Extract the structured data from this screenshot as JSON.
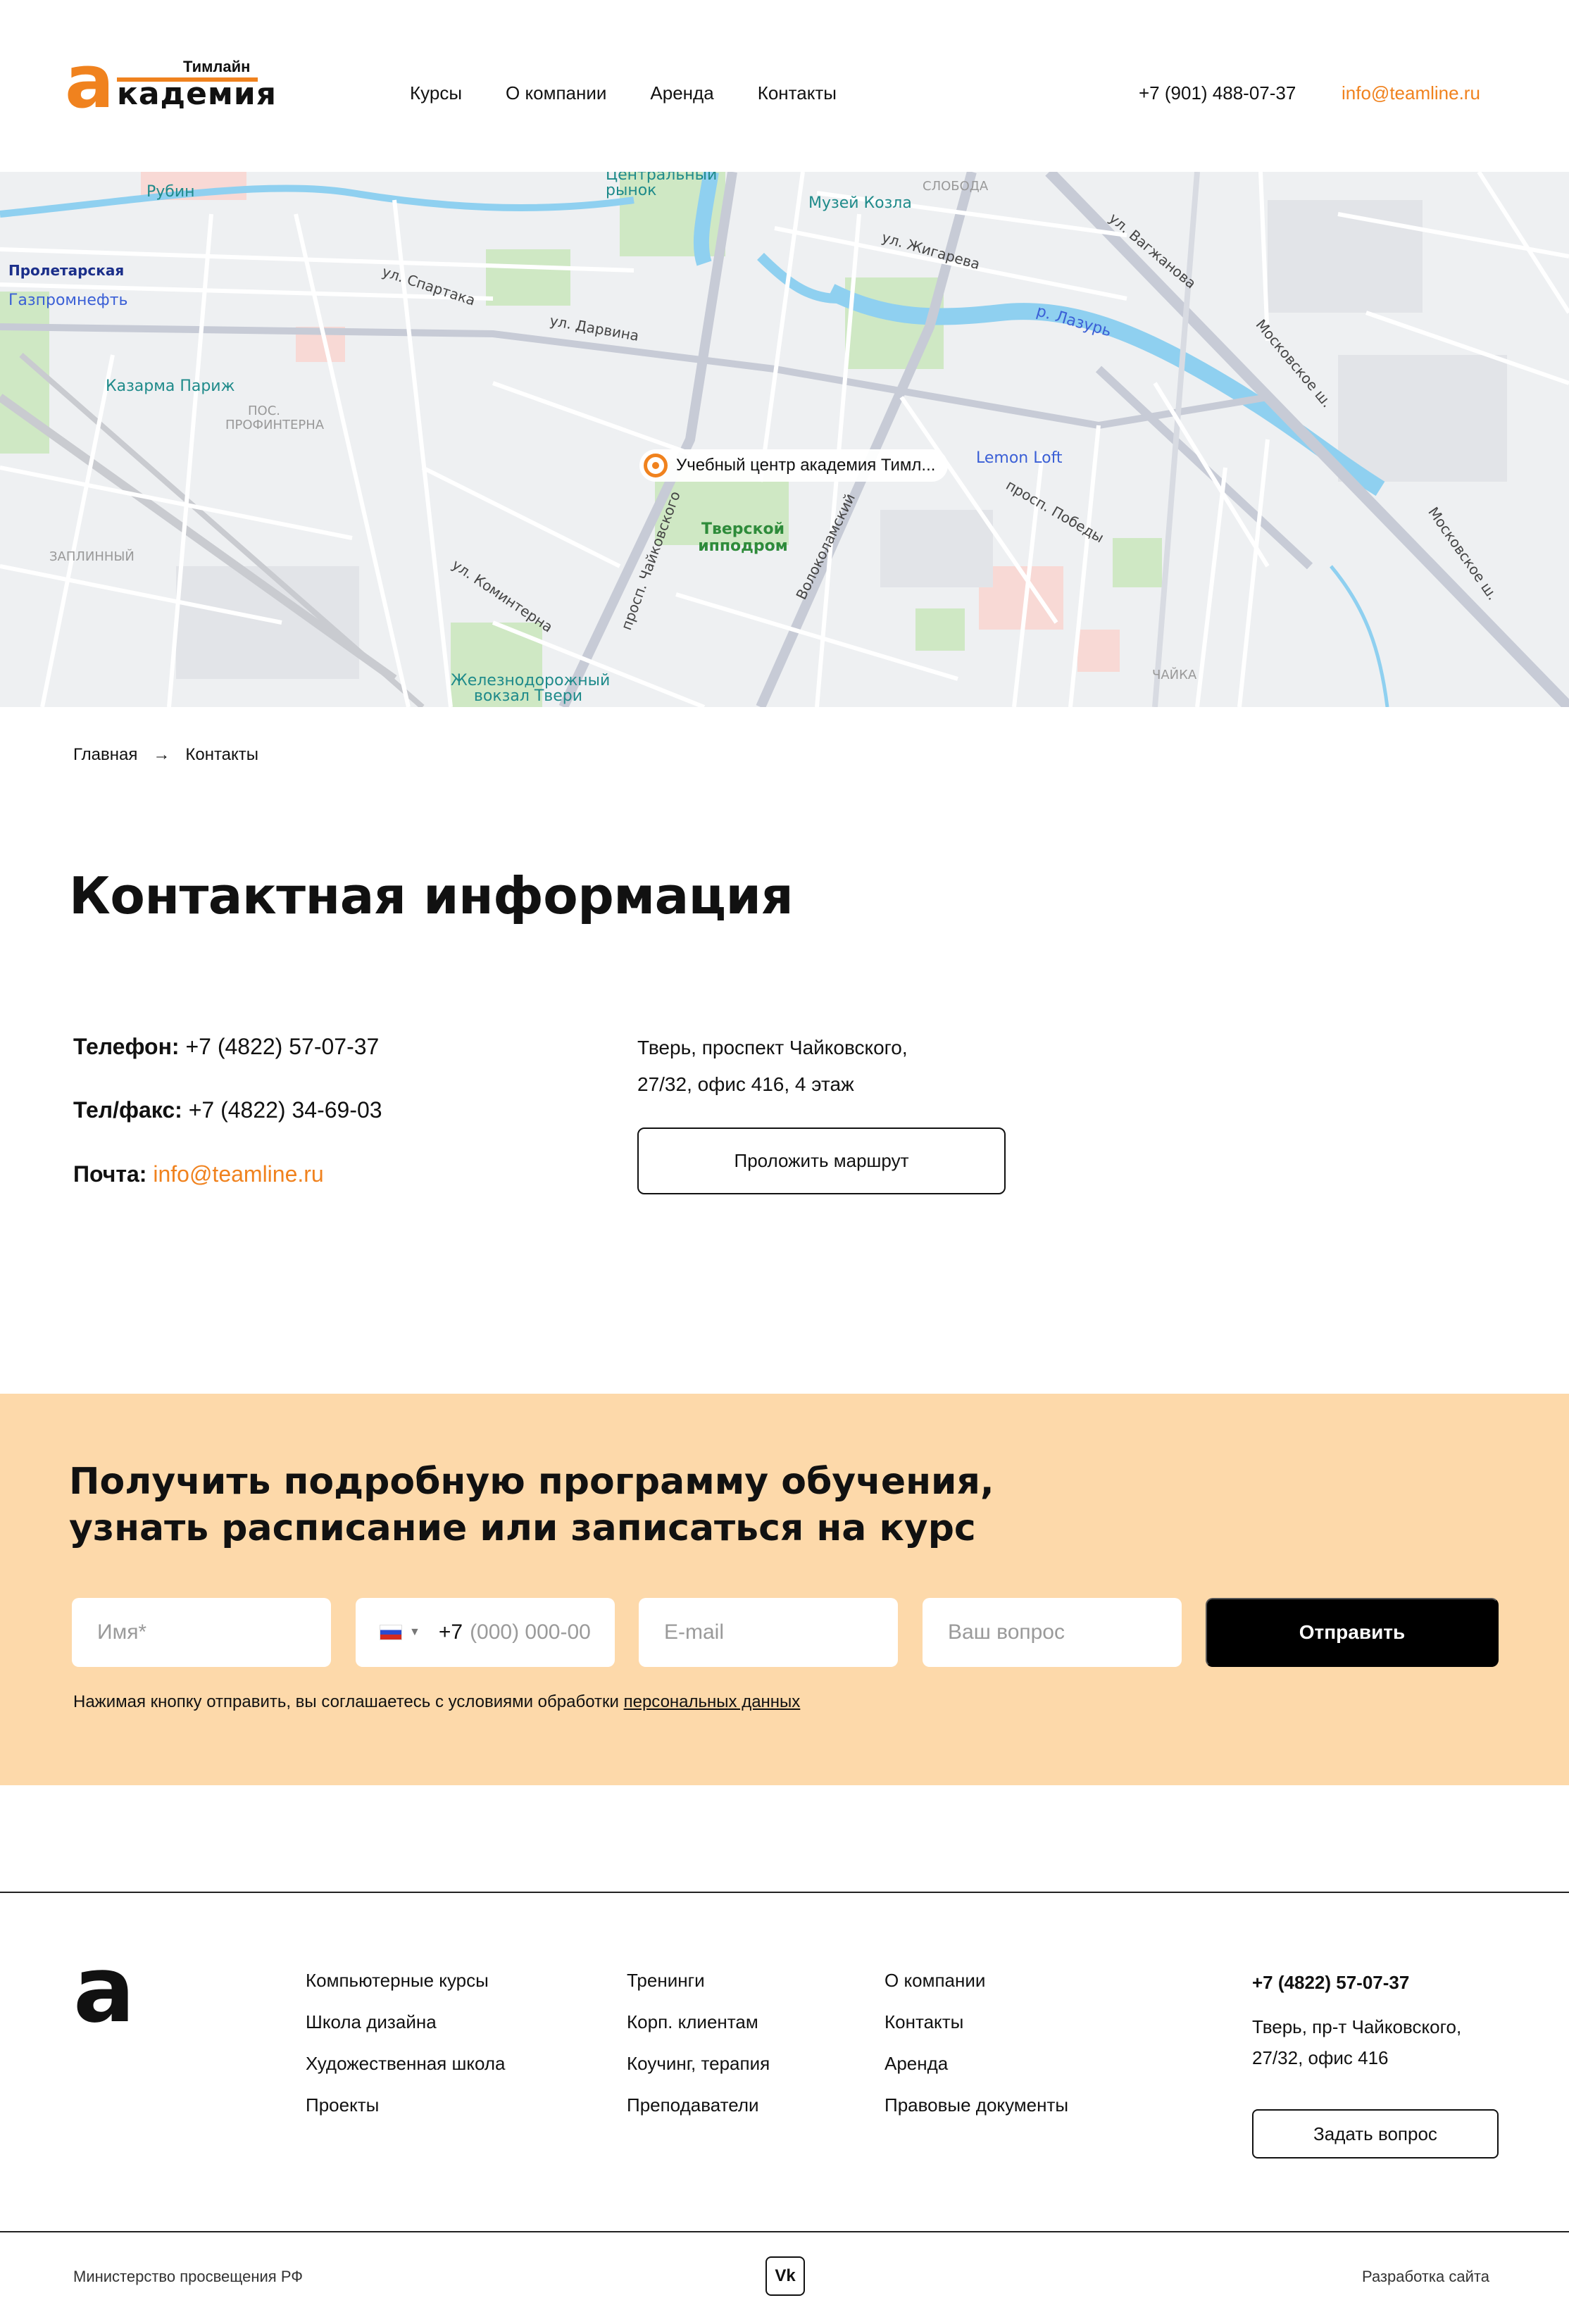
{
  "header": {
    "logo_small": "Тимлайн",
    "logo_big": "а",
    "logo_word": "кадемия",
    "nav": [
      "Курсы",
      "О компании",
      "Аренда",
      "Контакты"
    ],
    "phone": "+7 (901) 488-07-37",
    "email": "info@teamline.ru",
    "accent_color": "#f0821e"
  },
  "map": {
    "pin_label": "Учебный центр академия Тимл...",
    "labels": {
      "rubin": "Рубин",
      "market": "Центральный рынок",
      "museum": "Музей Козла",
      "proletarskaya": "Пролетарская",
      "gazprom": "Газпромнефть",
      "kazarma": "Казарма Париж",
      "hippodrome": "Тверской ипподром",
      "lemon": "Lemon Loft",
      "station": "Железнодорожный вокзал Твери",
      "chaikovskogo": "просп. Чайковского",
      "volokolamsky": "Волоколамский",
      "vagzhanova": "ул. Вагжанова",
      "moskovskoe": "Московское ш.",
      "zhigareva": "ул. Жигарева",
      "darvina": "ул. Дарвина",
      "spartaka": "ул. Спартака",
      "pobedy": "просп. Победы",
      "lazur": "р. Лазурь",
      "komintern": "ул. Коминтерна",
      "zaplinny": "ЗАПЛИННЫЙ",
      "chaika": "ЧАЙКА",
      "sloboda": "СЛОБОДА",
      "profintern": "ПОС. ПРОФИНТЕРНА"
    }
  },
  "breadcrumb": {
    "home": "Главная",
    "arrow": "→",
    "current": "Контакты"
  },
  "contacts": {
    "title": "Контактная информация",
    "phone_label": "Телефон:",
    "phone_value": "+7 (4822) 57-07-37",
    "fax_label": "Тел/факс:",
    "fax_value": "+7 (4822) 34-69-03",
    "mail_label": "Почта:",
    "mail_value": "info@teamline.ru",
    "address_line1": "Тверь, проспект Чайковского,",
    "address_line2": "27/32, офис 416, 4 этаж",
    "route_button": "Проложить маршрут"
  },
  "form": {
    "title_line1": "Получить подробную программу обучения,",
    "title_line2": "узнать расписание или записаться на курс",
    "name_placeholder": "Имя*",
    "phone_prefix": "+7",
    "phone_placeholder": "(000) 000-00",
    "email_placeholder": "E-mail",
    "question_placeholder": "Ваш вопрос",
    "submit": "Отправить",
    "consent_text": "Нажимая кнопку отправить, вы соглашаетесь с условиями обработки ",
    "consent_link": "персональных данных",
    "band_color": "#fdd9aa"
  },
  "footer": {
    "logo": "а",
    "col1": [
      "Компьютерные курсы",
      "Школа дизайна",
      "Художественная школа",
      "Проекты"
    ],
    "col2": [
      "Тренинги",
      "Корп. клиентам",
      "Коучинг, терапия",
      "Преподаватели"
    ],
    "col3": [
      "О компании",
      "Контакты",
      "Аренда",
      "Правовые документы"
    ],
    "phone": "+7 (4822) 57-07-37",
    "address_line1": "Тверь, пр-т Чайковского,",
    "address_line2": "27/32, офис 416",
    "ask_button": "Задать вопрос",
    "ministry": "Министерство просвещения РФ",
    "vk": "Vk",
    "dev": "Разработка сайта"
  }
}
